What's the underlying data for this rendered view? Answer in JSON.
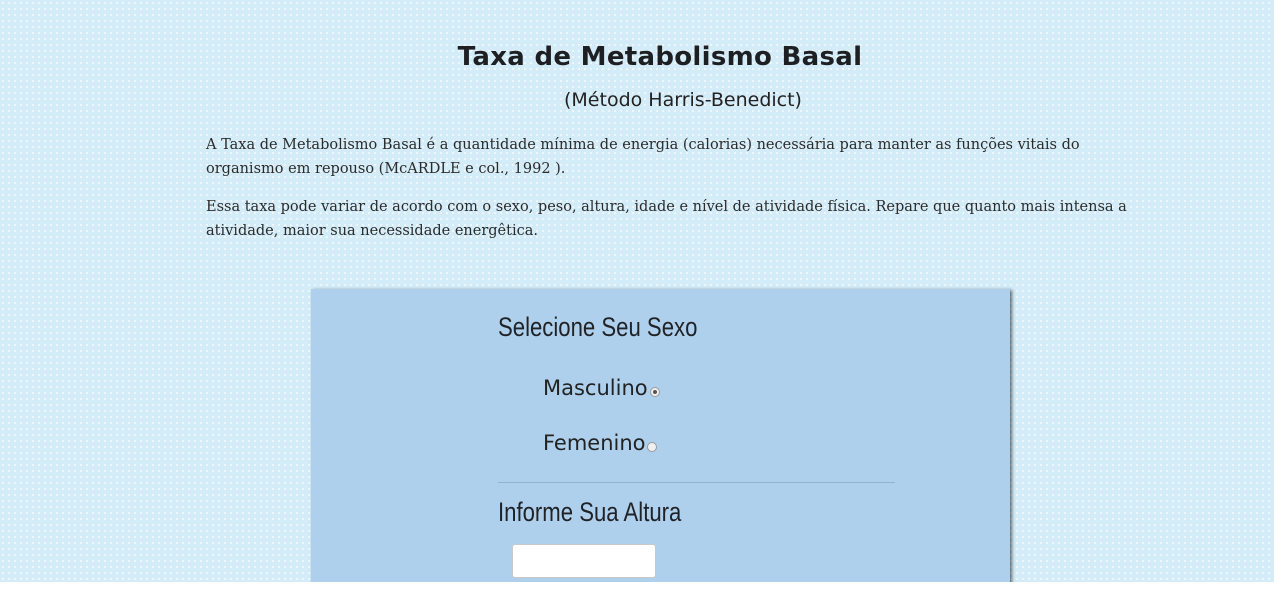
{
  "header": {
    "title": "Taxa de Metabolismo Basal",
    "subtitle": "(Método Harris-Benedict)"
  },
  "intro": {
    "paragraph1": "A Taxa de Metabolismo Basal é a quantidade mínima de energia (calorias) necessária para manter as funções vitais do organismo em repouso (McARDLE e col., 1992 ).",
    "paragraph2": "Essa taxa pode variar de acordo com o sexo, peso, altura, idade e nível de atividade física. Repare que quanto mais intensa a atividade, maior sua necessidade energêtica."
  },
  "form": {
    "sex_heading": "Selecione Seu Sexo",
    "sex_options": [
      {
        "label": "Masculino",
        "selected": true
      },
      {
        "label": "Femenino",
        "selected": false
      }
    ],
    "height_heading": "Informe Sua Altura",
    "height_value": ""
  },
  "colors": {
    "page_background": "#d3ecf7",
    "panel_background": "#afd0ec",
    "text": "#222222"
  }
}
